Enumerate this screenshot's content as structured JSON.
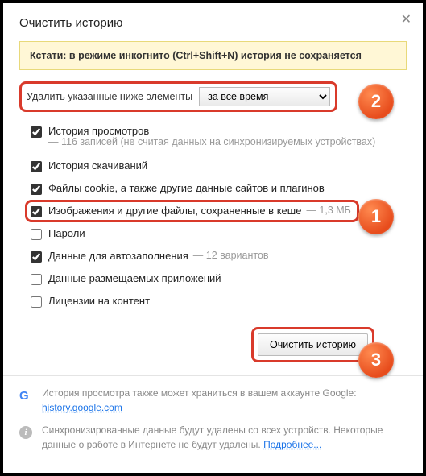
{
  "title": "Очистить историю",
  "banner": "Кстати: в режиме инкогнито (Ctrl+Shift+N) история не сохраняется",
  "range": {
    "label": "Удалить указанные ниже элементы",
    "selected": "за все время"
  },
  "options": {
    "browsing": {
      "label": "История просмотров",
      "detail": "— 116 записей (не считая данных на синхронизируемых устройствах)",
      "checked": true
    },
    "downloads": {
      "label": "История скачиваний",
      "checked": true
    },
    "cookies": {
      "label": "Файлы cookie, а также другие данные сайтов и плагинов",
      "checked": true
    },
    "cache": {
      "label": "Изображения и другие файлы, сохраненные в кеше",
      "detail": "— 1,3 МБ",
      "checked": true
    },
    "passwords": {
      "label": "Пароли",
      "checked": false
    },
    "autofill": {
      "label": "Данные для автозаполнения",
      "detail": "— 12 вариантов",
      "checked": true
    },
    "hosted": {
      "label": "Данные размещаемых приложений",
      "checked": false
    },
    "licenses": {
      "label": "Лицензии на контент",
      "checked": false
    }
  },
  "clear_button": "Очистить историю",
  "footer": {
    "google_text": "История просмотра также может храниться в вашем аккаунте Google:",
    "google_link": "history.google.com",
    "sync_text1": "Синхронизированные данные будут удалены со всех устройств. Некоторые данные о работе в Интернете не будут удалены.",
    "sync_link": "Подробнее..."
  },
  "badges": {
    "b1": "1",
    "b2": "2",
    "b3": "3"
  }
}
